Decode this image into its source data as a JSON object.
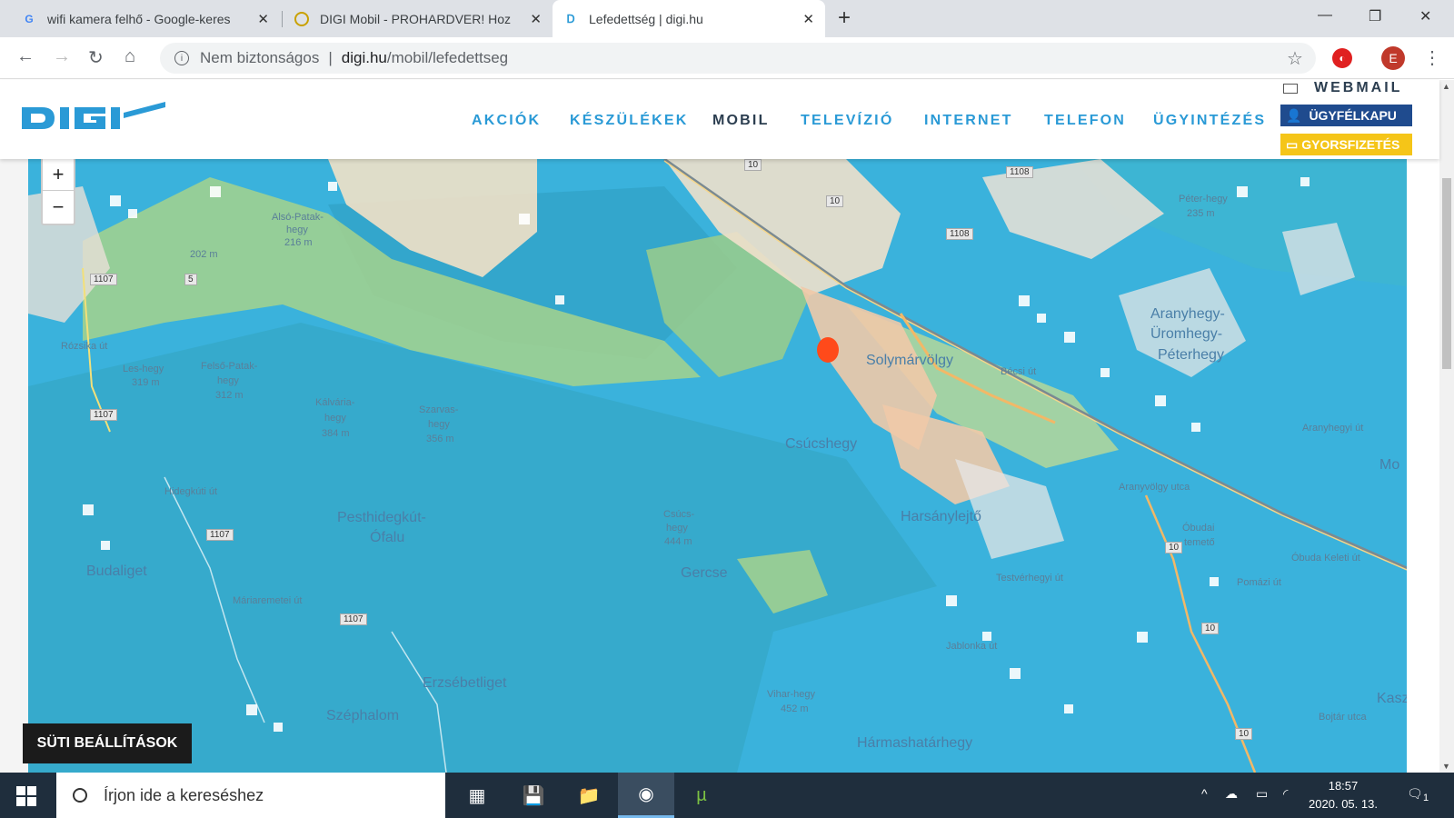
{
  "browser": {
    "tabs": [
      {
        "title": "wifi kamera felhő - Google-keres",
        "favicon": "G"
      },
      {
        "title": "DIGI Mobil - PROHARDVER! Hoz",
        "favicon": "P"
      },
      {
        "title": "Lefedettség | digi.hu",
        "favicon": "D"
      }
    ],
    "address": {
      "insecure_label": "Nem biztonságos",
      "domain": "digi.hu",
      "path": "/mobil/lefedettseg"
    },
    "ext_label": "",
    "avatar_letter": "E"
  },
  "site": {
    "logo_text": "DIGI",
    "nav": [
      "AKCIÓK",
      "KÉSZÜLÉKEK",
      "MOBIL",
      "TELEVÍZIÓ",
      "INTERNET",
      "TELEFON",
      "ÜGYINTÉZÉS"
    ],
    "active_nav": "MOBIL",
    "webmail": "WEBMAIL",
    "ugyfelkapu": "ÜGYFÉLKAPU",
    "gyorsfizetes": "GYORSFIZETÉS",
    "brand_color": "#2a9ad6"
  },
  "map": {
    "zoom_in": "+",
    "zoom_out": "−",
    "labels": {
      "solymarvolgy": "Solymárvölgy",
      "csucshegy": "Csúcshegy",
      "harsanylejto": "Harsánylejtő",
      "pesthidegkut": "Pesthidegkút-",
      "ofalu": "Ófalu",
      "budaliget": "Budaliget",
      "gercse": "Gercse",
      "erzsebetliget": "Erzsébetliget",
      "szephalom": "Széphalom",
      "harmashatarhegy": "Hármashatárhegy",
      "aranyhegy": "Aranyhegy-",
      "uromhegy": "Üromhegy-",
      "peterhegy": "Péterhegy",
      "also_patak": "Alsó-Patak-",
      "hegy_216": "hegy",
      "m216": "216 m",
      "m202": "202 m",
      "les_hegy": "Les-hegy",
      "m319": "319 m",
      "felso_patak": "Felső-Patak-",
      "hegy_312": "hegy",
      "m312": "312 m",
      "kalvaria": "Kálvária-",
      "hegy_384": "hegy",
      "m384": "384 m",
      "szarvas": "Szarvas-",
      "hegy_356": "hegy",
      "m356": "356 m",
      "csucs": "Csúcs-",
      "hegy_444": "hegy",
      "m444": "444 m",
      "vihar": "Vihar-hegy",
      "m452": "452 m",
      "peter_hegy": "Péter-hegy",
      "m235": "235 m",
      "obudai": "Óbudai",
      "temeto": "temető",
      "obuda_kel": "Óbuda Keleti út",
      "mo": "Mo",
      "kasz": "Kasz",
      "becsi": "Bécsi út",
      "aranyvolgy": "Aranyvölgy utca",
      "testver": "Testvérhegyi út",
      "jablonka": "Jablonka út",
      "bojtar": "Bojtár utca",
      "hidegkuti": "Hidegkúti út",
      "maria": "Máriaremetei út",
      "roszika": "Rózsika út",
      "pomazi": "Pomázi út",
      "aranyhegyi": "Aranyhegyi út"
    },
    "roads": [
      "1108",
      "1108",
      "1107",
      "1107",
      "1107",
      "1107",
      "10",
      "10",
      "10",
      "10",
      "10",
      "5"
    ]
  },
  "cookie_button": "SÜTI BEÁLLÍTÁSOK",
  "taskbar": {
    "search_placeholder": "Írjon ide a kereséshez",
    "time": "18:57",
    "date": "2020. 05. 13.",
    "notif_count": "1"
  }
}
